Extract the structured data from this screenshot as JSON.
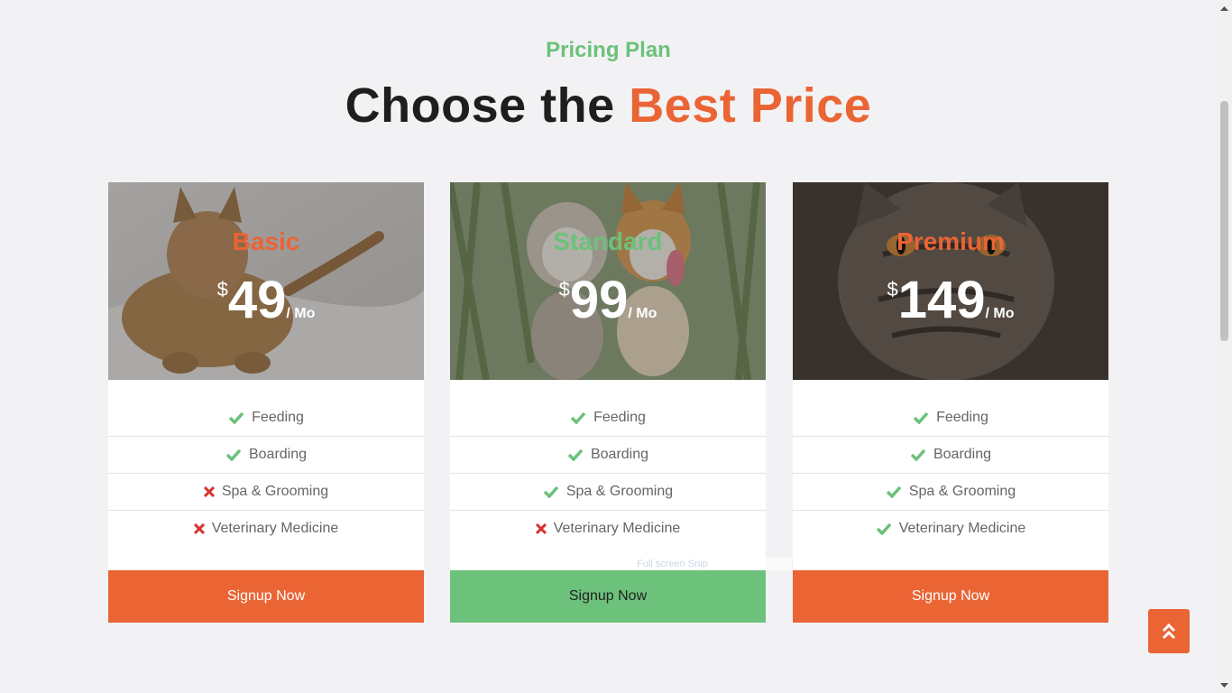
{
  "section": {
    "subtitle": "Pricing Plan",
    "title_main": "Choose the",
    "title_accent": "Best Price"
  },
  "colors": {
    "orange": "#ea6434",
    "green": "#6cc17b",
    "red": "#d63333"
  },
  "plans": [
    {
      "name": "Basic",
      "currency": "$",
      "price": "49",
      "period": "/ Mo",
      "image": "cat-lying-on-bed",
      "features": [
        {
          "label": "Feeding",
          "included": true
        },
        {
          "label": "Boarding",
          "included": true
        },
        {
          "label": "Spa & Grooming",
          "included": false
        },
        {
          "label": "Veterinary Medicine",
          "included": false
        }
      ],
      "button": "Signup Now"
    },
    {
      "name": "Standard",
      "currency": "$",
      "price": "99",
      "period": "/ Mo",
      "image": "two-dogs-running",
      "features": [
        {
          "label": "Feeding",
          "included": true
        },
        {
          "label": "Boarding",
          "included": true
        },
        {
          "label": "Spa & Grooming",
          "included": true
        },
        {
          "label": "Veterinary Medicine",
          "included": false
        }
      ],
      "button": "Signup Now"
    },
    {
      "name": "Premium",
      "currency": "$",
      "price": "149",
      "period": "/ Mo",
      "image": "tabby-cat-closeup",
      "features": [
        {
          "label": "Feeding",
          "included": true
        },
        {
          "label": "Boarding",
          "included": true
        },
        {
          "label": "Spa & Grooming",
          "included": true
        },
        {
          "label": "Veterinary Medicine",
          "included": true
        }
      ],
      "button": "Signup Now"
    }
  ],
  "overlay_tip": "Full screen Snip",
  "back_to_top_icon": "double-chevron-up-icon"
}
